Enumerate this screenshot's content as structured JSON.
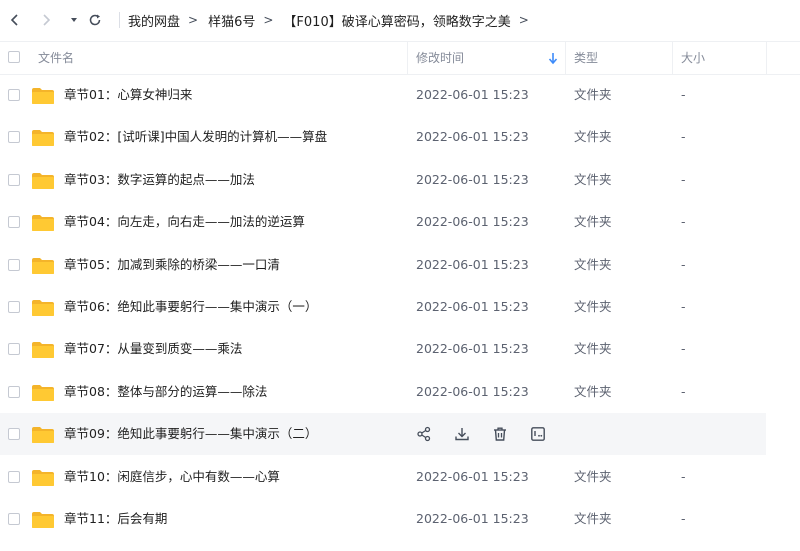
{
  "breadcrumb": {
    "items": [
      "我的网盘",
      "样猫6号",
      "【F010】破译心算密码，领略数字之美"
    ]
  },
  "table": {
    "headers": {
      "name": "文件名",
      "modified": "修改时间",
      "type": "类型",
      "size": "大小"
    },
    "rows": [
      {
        "name": "章节01：心算女神归来",
        "modified": "2022-06-01 15:23",
        "type": "文件夹",
        "size": "-"
      },
      {
        "name": "章节02：[试听课]中国人发明的计算机——算盘",
        "modified": "2022-06-01 15:23",
        "type": "文件夹",
        "size": "-"
      },
      {
        "name": "章节03：数字运算的起点——加法",
        "modified": "2022-06-01 15:23",
        "type": "文件夹",
        "size": "-"
      },
      {
        "name": "章节04：向左走，向右走——加法的逆运算",
        "modified": "2022-06-01 15:23",
        "type": "文件夹",
        "size": "-"
      },
      {
        "name": "章节05：加减到乘除的桥梁——一口清",
        "modified": "2022-06-01 15:23",
        "type": "文件夹",
        "size": "-"
      },
      {
        "name": "章节06：绝知此事要躬行——集中演示（一）",
        "modified": "2022-06-01 15:23",
        "type": "文件夹",
        "size": "-"
      },
      {
        "name": "章节07：从量变到质变——乘法",
        "modified": "2022-06-01 15:23",
        "type": "文件夹",
        "size": "-"
      },
      {
        "name": "章节08：整体与部分的运算——除法",
        "modified": "2022-06-01 15:23",
        "type": "文件夹",
        "size": "-"
      },
      {
        "name": "章节09：绝知此事要躬行——集中演示（二）",
        "modified": "",
        "type": "",
        "size": "",
        "hovered": true
      },
      {
        "name": "章节10：闲庭信步，心中有数——心算",
        "modified": "2022-06-01 15:23",
        "type": "文件夹",
        "size": "-"
      },
      {
        "name": "章节11：后会有期",
        "modified": "2022-06-01 15:23",
        "type": "文件夹",
        "size": "-"
      }
    ]
  },
  "row_actions": [
    "share-icon",
    "download-icon",
    "delete-icon",
    "more-icon"
  ],
  "colors": {
    "folder": "#ffc933",
    "folder_dark": "#f4b42a",
    "sort_arrow": "#3d8bfa",
    "hover_row": "#f5f6f8"
  }
}
